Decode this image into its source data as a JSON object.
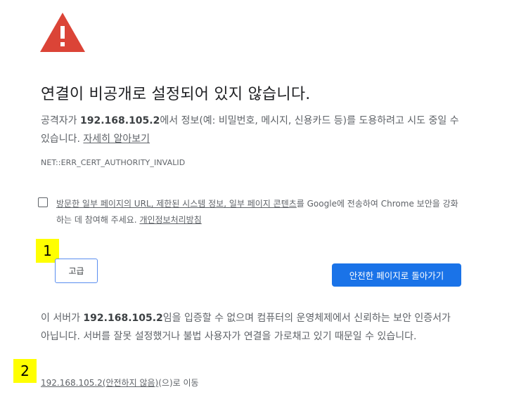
{
  "icon": "warning-triangle-icon",
  "colors": {
    "warning_red": "#db4437",
    "primary_blue": "#1a73e8"
  },
  "title": "연결이 비공개로 설정되어 있지 않습니다.",
  "intro": {
    "part1": "공격자가 ",
    "host": "192.168.105.2",
    "part2": "에서 정보(예: 비밀번호, 메시지, 신용카드 등)를 도용하려고 시도 중일 수 있습니다. ",
    "learn_more": "자세히 알아보기"
  },
  "error_code": "NET::ERR_CERT_AUTHORITY_INVALID",
  "optin": {
    "link_text": "방문한 일부 페이지의 URL, 제한된 시스템 정보, 일부 페이지 콘텐츠",
    "text_mid": "를 Google에 전송하여 Chrome 보안을 강화하는 데 참여해 주세요. ",
    "privacy_link": "개인정보처리방침"
  },
  "buttons": {
    "advanced": "고급",
    "back_to_safety": "안전한 페이지로 돌아가기"
  },
  "details": {
    "part1": "이 서버가 ",
    "host": "192.168.105.2",
    "part2": "임을 입증할 수 없으며 컴퓨터의 운영체제에서 신뢰하는 보안 인증서가 아닙니다. 서버를 잘못 설정했거나 불법 사용자가 연결을 가로채고 있기 때문일 수 있습니다."
  },
  "proceed": {
    "link": "192.168.105.2(안전하지 않음)",
    "suffix": "(으)로 이동"
  },
  "annotations": {
    "marker1": "1",
    "marker2": "2"
  }
}
